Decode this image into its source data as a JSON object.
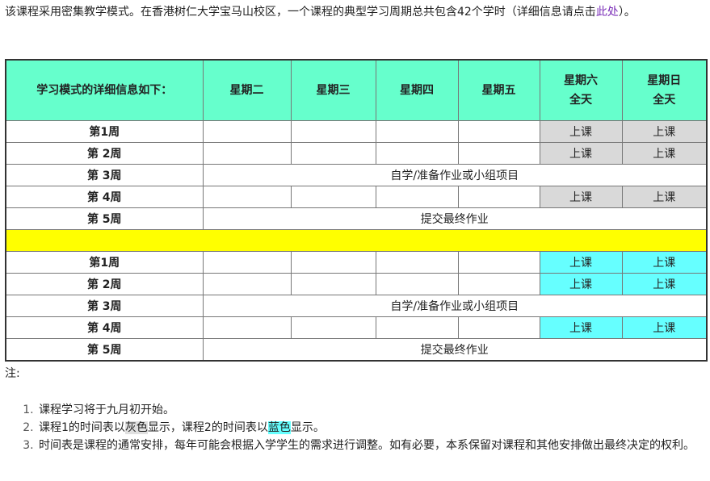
{
  "intro": {
    "text": "该课程采用密集教学模式。在香港树仁大学宝马山校区，一个课程的典型学习周期总共包含42个学时（详细信息请点击",
    "link": "此处",
    "after": "）。"
  },
  "table": {
    "header": {
      "first": "学习模式的详细信息如下：",
      "tue": "星期二",
      "wed": "星期三",
      "thu": "星期四",
      "fri": "星期五",
      "sat_line1": "星期六",
      "sat_line2": "全天",
      "sun_line1": "星期日",
      "sun_line2": "全天"
    },
    "course1": {
      "w1": "第1周",
      "w2": "第 2周",
      "w3": "第 3周",
      "w4": "第 4周",
      "w5": "第 5周",
      "class_label": "上课",
      "self_study": "自学/准备作业或小组项目",
      "submit": "提交最终作业"
    },
    "course2": {
      "w1": "第1周",
      "w2": "第 2周",
      "w3": "第 3周",
      "w4": "第 4周",
      "w5": "第 5周",
      "class_label": "上课",
      "self_study": "自学/准备作业或小组项目",
      "submit": "提交最终作业"
    },
    "colors": {
      "header_bg": "#66ffcc",
      "course1_class_bg": "#d9d9d9",
      "course2_class_bg": "#66ffff",
      "separator_bg": "#ffff00"
    }
  },
  "notes": {
    "label": "注:",
    "item1": "课程学习将于九月初开始。",
    "item2_a": "课程1的时间表以",
    "item2_grey": "灰色",
    "item2_b": "显示，课程2的时间表以",
    "item2_blue": "蓝色",
    "item2_c": "显示。",
    "item3": "时间表是课程的通常安排，每年可能会根据入学学生的需求进行调整。如有必要，本系保留对课程和其他安排做出最终决定的权利。"
  }
}
